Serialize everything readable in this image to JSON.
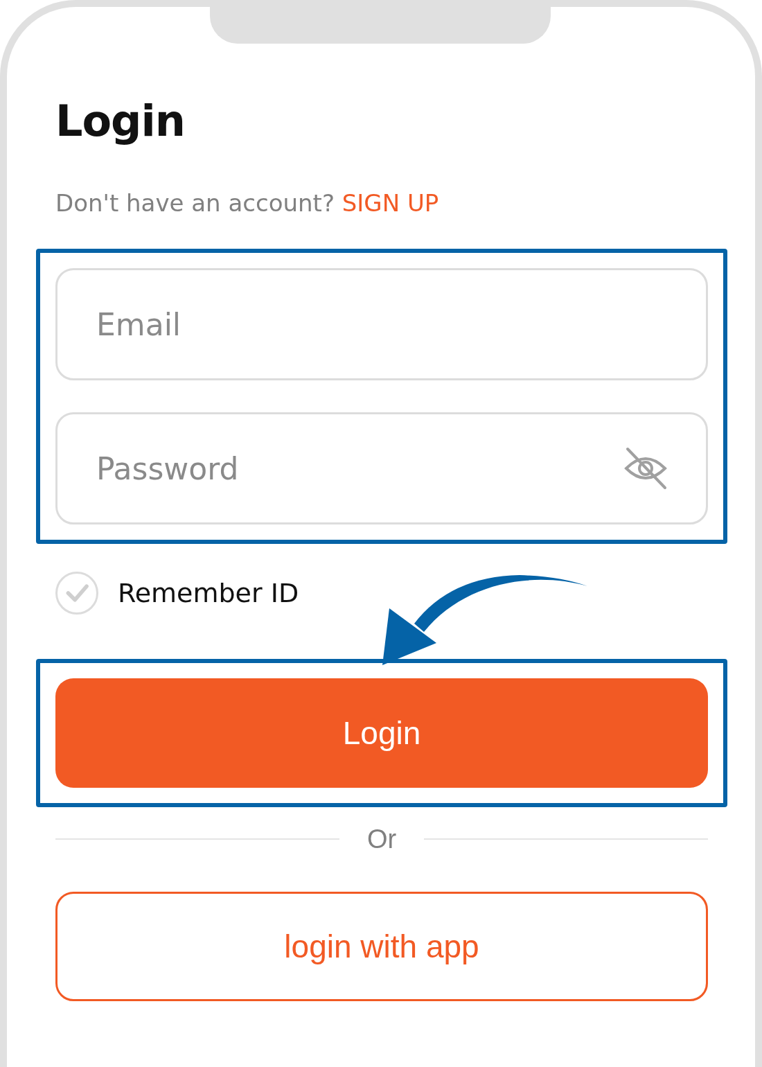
{
  "title": "Login",
  "signup_prompt": {
    "text": "Don't have an account?",
    "link": "SIGN UP"
  },
  "fields": [
    {
      "kind": "text",
      "placeholder": "Email"
    },
    {
      "kind": "password",
      "placeholder": "Password"
    }
  ],
  "remember": {
    "label": "Remember ID",
    "checked": false
  },
  "login_button": "Login",
  "divider": "Or",
  "app_button": "login with app"
}
